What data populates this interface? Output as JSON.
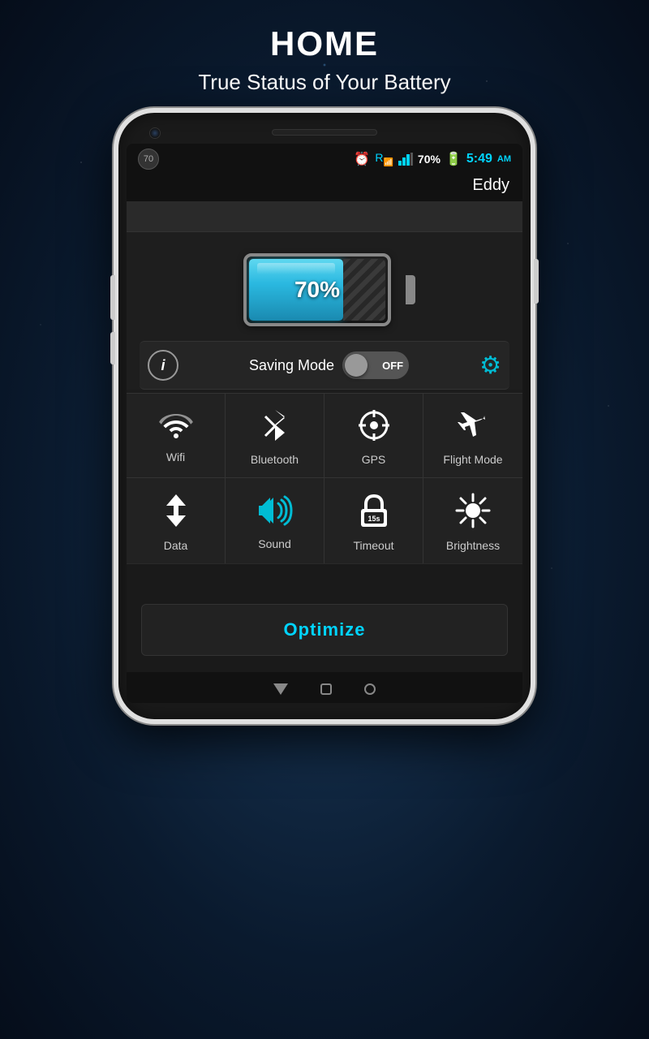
{
  "page": {
    "title": "HOME",
    "subtitle": "True Status of Your Battery"
  },
  "status_bar": {
    "badge_number": "70",
    "alarm_icon": "⏰",
    "signal_icon": "📶",
    "battery_percent": "70%",
    "battery_icon": "🔋",
    "time": "5:49",
    "ampm": "AM",
    "username": "Eddy"
  },
  "battery": {
    "percent": "70%",
    "fill_width": "70%"
  },
  "saving_mode": {
    "label": "Saving Mode",
    "state": "OFF",
    "info_icon": "i",
    "gear_icon": "⚙"
  },
  "quick_toggles_row1": [
    {
      "id": "wifi",
      "label": "Wifi",
      "icon": "wifi"
    },
    {
      "id": "bluetooth",
      "label": "Bluetooth",
      "icon": "bluetooth"
    },
    {
      "id": "gps",
      "label": "GPS",
      "icon": "gps"
    },
    {
      "id": "flight-mode",
      "label": "Flight Mode",
      "icon": "flight"
    }
  ],
  "quick_toggles_row2": [
    {
      "id": "data",
      "label": "Data",
      "icon": "data"
    },
    {
      "id": "sound",
      "label": "Sound",
      "icon": "sound"
    },
    {
      "id": "timeout",
      "label": "Timeout",
      "icon": "timeout"
    },
    {
      "id": "brightness",
      "label": "Brightness",
      "icon": "brightness"
    }
  ],
  "optimize_button": {
    "label": "Optimize"
  },
  "timeout_label": "15s"
}
